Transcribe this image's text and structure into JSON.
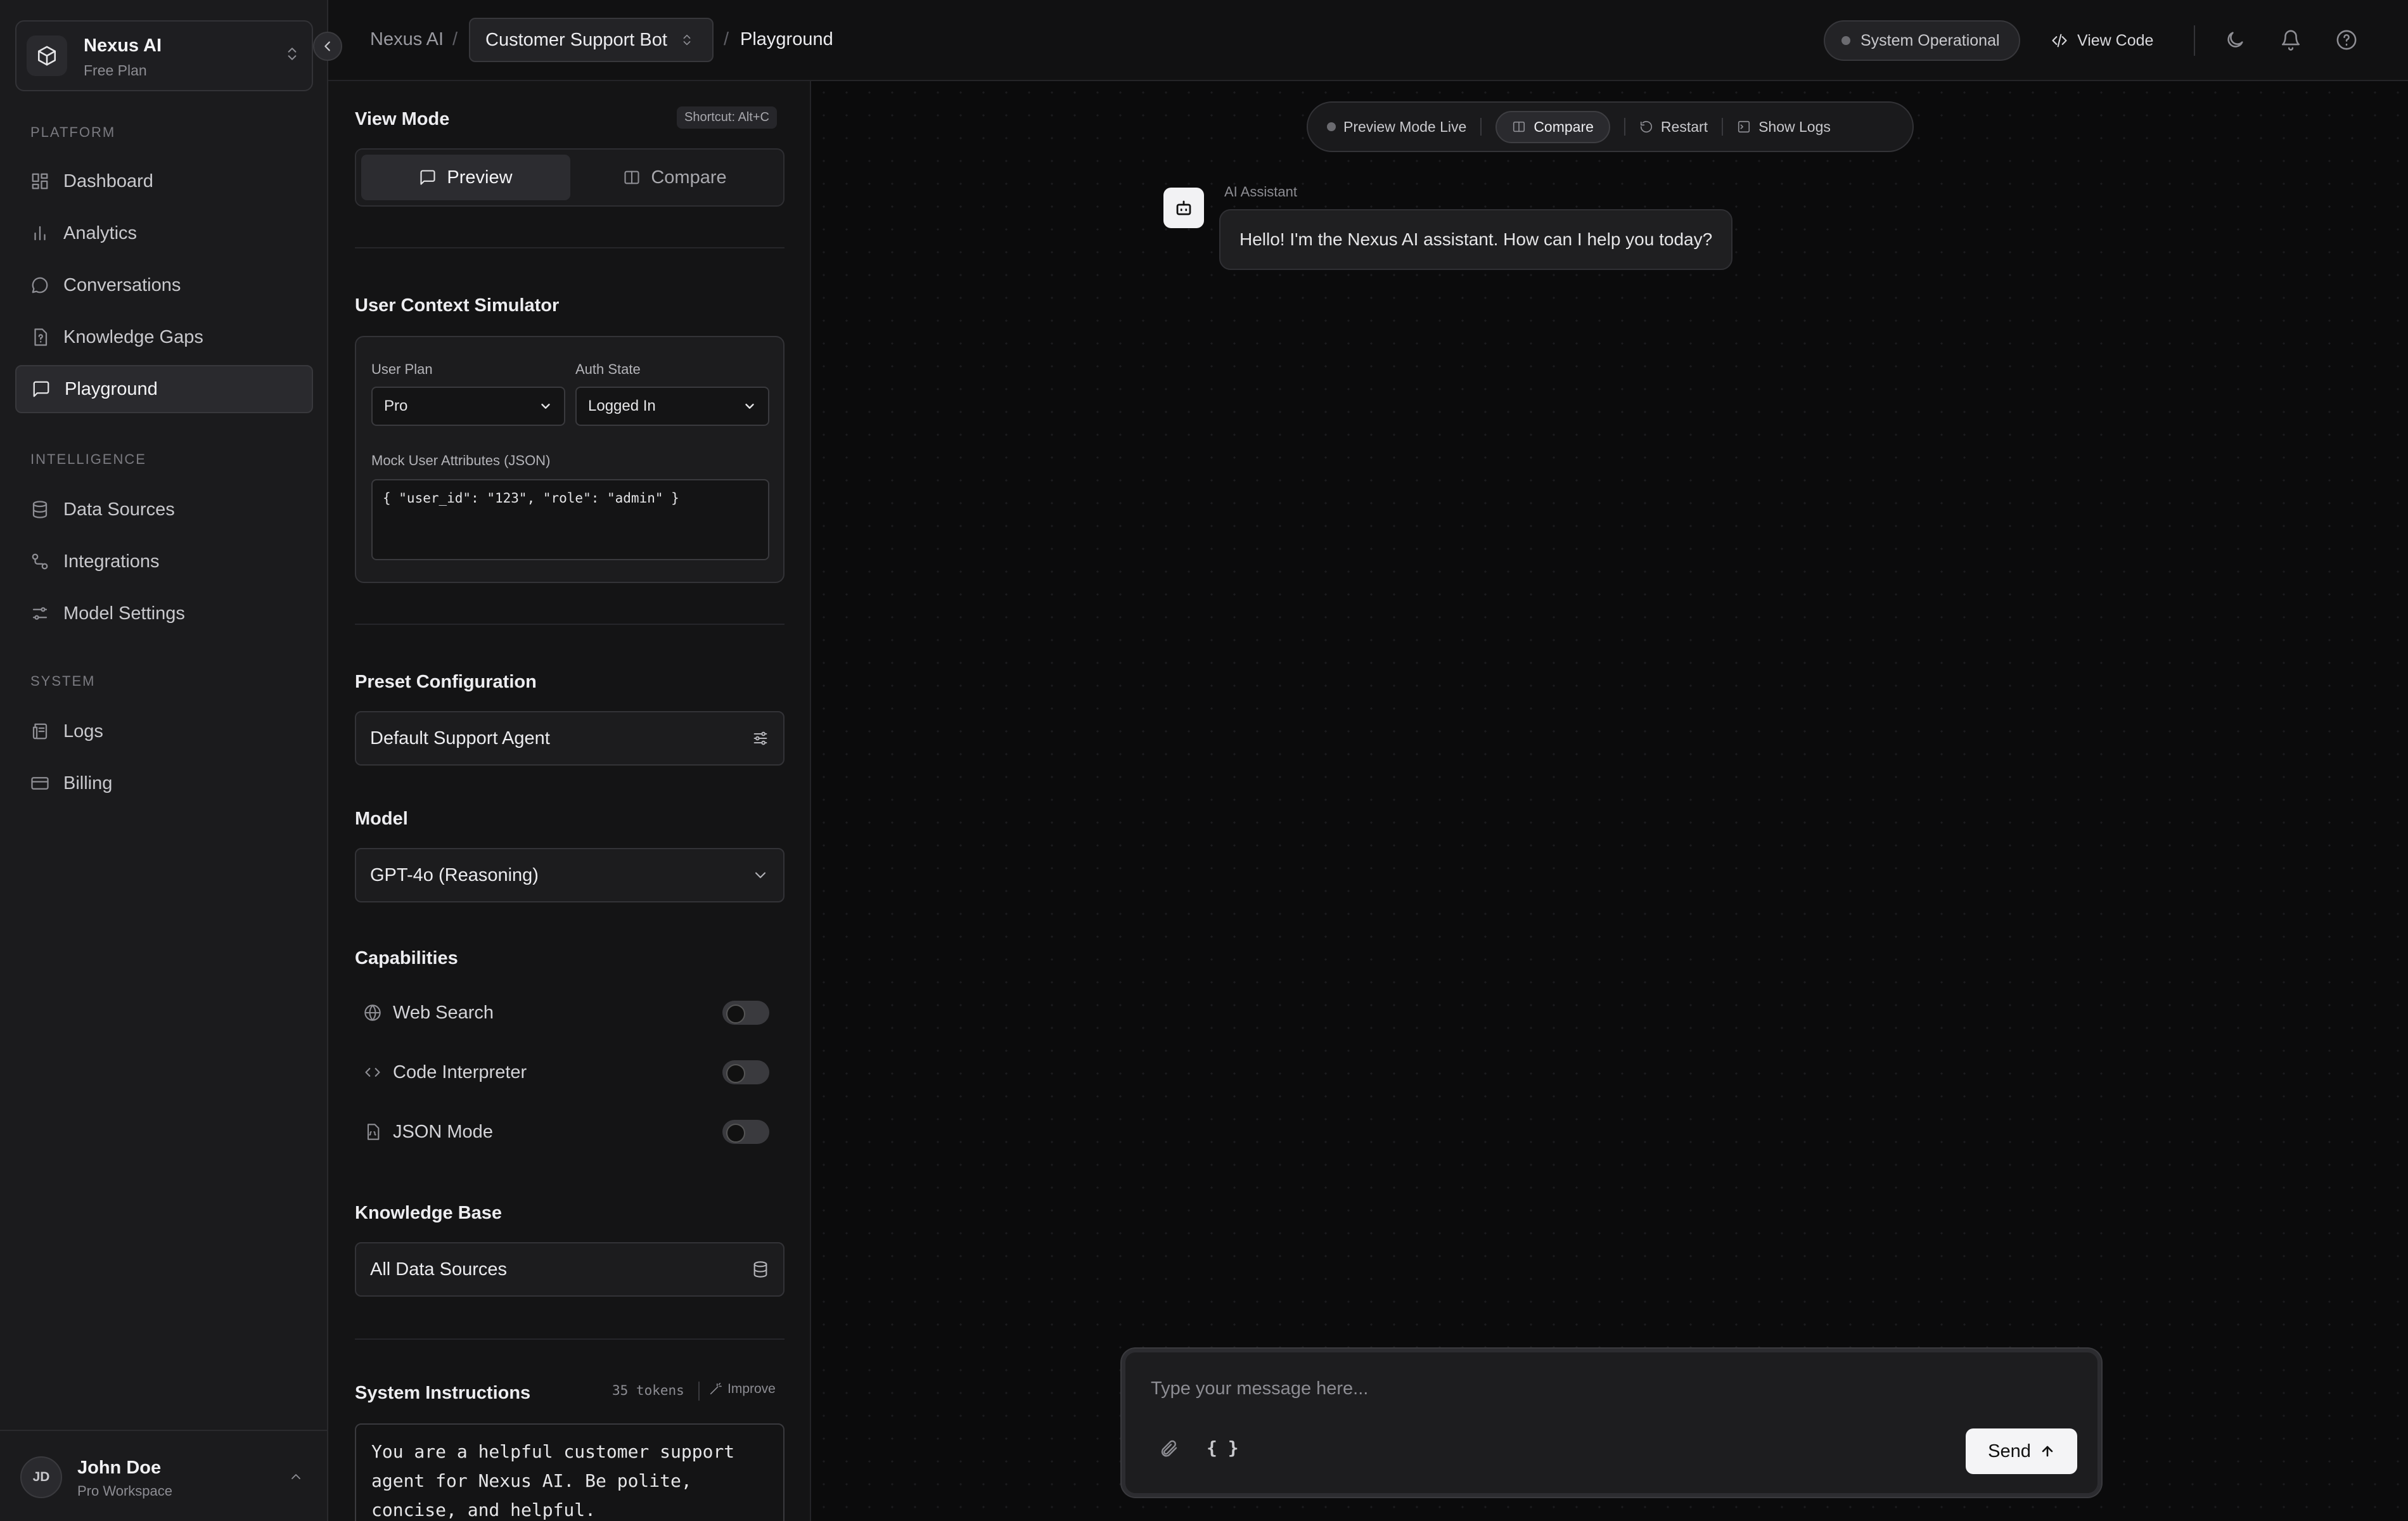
{
  "workspace": {
    "name": "Nexus AI",
    "plan": "Free Plan"
  },
  "sidebar": {
    "sections": [
      {
        "label": "PLATFORM",
        "items": [
          {
            "label": "Dashboard",
            "icon": "dashboard-icon"
          },
          {
            "label": "Analytics",
            "icon": "bar-chart-icon"
          },
          {
            "label": "Conversations",
            "icon": "chat-bubble-icon"
          },
          {
            "label": "Knowledge Gaps",
            "icon": "file-question-icon"
          },
          {
            "label": "Playground",
            "icon": "message-square-icon",
            "active": true
          }
        ]
      },
      {
        "label": "INTELLIGENCE",
        "items": [
          {
            "label": "Data Sources",
            "icon": "database-icon"
          },
          {
            "label": "Integrations",
            "icon": "workflow-icon"
          },
          {
            "label": "Model Settings",
            "icon": "sliders-icon"
          }
        ]
      },
      {
        "label": "SYSTEM",
        "items": [
          {
            "label": "Logs",
            "icon": "scroll-icon"
          },
          {
            "label": "Billing",
            "icon": "credit-card-icon"
          }
        ]
      }
    ]
  },
  "user": {
    "initials": "JD",
    "name": "John Doe",
    "workspace": "Pro Workspace"
  },
  "breadcrumb": {
    "root": "Nexus AI",
    "project": "Customer Support Bot",
    "page": "Playground"
  },
  "header": {
    "status": "System Operational",
    "view_code": "View Code"
  },
  "config": {
    "view_mode": {
      "title": "View Mode",
      "shortcut": "Shortcut: Alt+C",
      "preview": "Preview",
      "compare": "Compare",
      "selected": "Preview"
    },
    "context": {
      "title": "User Context Simulator",
      "plan_label": "User Plan",
      "plan_value": "Pro",
      "auth_label": "Auth State",
      "auth_value": "Logged In",
      "json_label": "Mock User Attributes (JSON)",
      "json_value": "{ \"user_id\": \"123\", \"role\": \"admin\" }"
    },
    "preset": {
      "title": "Preset Configuration",
      "value": "Default Support Agent"
    },
    "model": {
      "title": "Model",
      "value": "GPT-4o (Reasoning)"
    },
    "capabilities": {
      "title": "Capabilities",
      "items": [
        {
          "label": "Web Search",
          "icon": "globe-icon",
          "enabled": false
        },
        {
          "label": "Code Interpreter",
          "icon": "code-icon",
          "enabled": false
        },
        {
          "label": "JSON Mode",
          "icon": "file-json-icon",
          "enabled": false
        }
      ]
    },
    "knowledge": {
      "title": "Knowledge Base",
      "value": "All Data Sources"
    },
    "instructions": {
      "title": "System Instructions",
      "tokens": "35 tokens",
      "improve": "Improve",
      "value": "You are a helpful customer support\nagent for Nexus AI. Be polite,\nconcise, and helpful."
    }
  },
  "preview": {
    "toolbar": {
      "live": "Preview Mode Live",
      "compare": "Compare",
      "restart": "Restart",
      "logs": "Show Logs"
    },
    "message": {
      "sender": "AI Assistant",
      "text": "Hello! I'm the Nexus AI assistant. How can I help you today?"
    },
    "composer": {
      "placeholder": "Type your message here...",
      "json_label": "{ }",
      "send": "Send"
    }
  }
}
